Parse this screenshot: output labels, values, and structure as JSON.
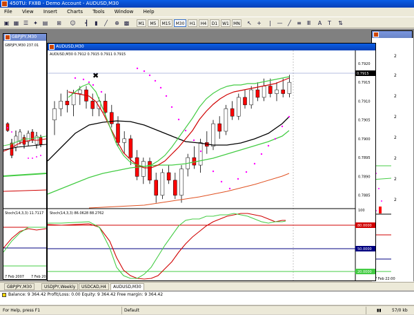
{
  "app": {
    "title": "450TU: FX8B - Demo Account - AUDUSD,M30"
  },
  "menu": [
    "File",
    "View",
    "Insert",
    "Charts",
    "Tools",
    "Window",
    "Help"
  ],
  "toolbar": {
    "timeframes": [
      "M1",
      "M5",
      "M15",
      "M30",
      "H1",
      "H4",
      "D1",
      "W1",
      "MN"
    ],
    "active_tf": "M30"
  },
  "windows": {
    "left": {
      "title": "GBPJPY,M30",
      "header": "GBPJPY,M30  237.01",
      "stoch_label": "Stoch(14,3,3) 11.7117",
      "dates": [
        "7 Feb 2007",
        "7 Feb 20"
      ]
    },
    "main": {
      "title": "AUDUSD,M30",
      "header": "AUDUSD,M30  0.7912 0.7915 0.7911 0.7915",
      "stoch_label": "Stoch(14,3,3) 86.0628 88.2762"
    },
    "behind": {
      "title": "",
      "date": "7 Feb 22:00"
    }
  },
  "tabs": [
    "GBPJPY,M30",
    "USDJPY,Weekly",
    "USDCAD,H4",
    "AUDUSD,M30"
  ],
  "active_tab": "AUDUSD,M30",
  "terminal": {
    "balance_line": "Balance: 9 364.42  Profit/Loss: 0.00  Equity: 9 364.42  Free margin: 9 364.42"
  },
  "status": {
    "help": "For Help, press F1",
    "profile": "Default",
    "traffic": "57/0 kb"
  },
  "colors": {
    "bull": "#ffffff",
    "bear": "#ff0000",
    "ma_red": "#d00000",
    "ma_green": "#44cc44",
    "ma_black": "#000000",
    "sar": "#ff00ff",
    "stoch_main": "#d00000",
    "stoch_signal": "#44cc44"
  },
  "chart_data": {
    "type": "candlestick",
    "symbol": "AUDUSD",
    "timeframe": "M30",
    "price_ticks": [
      "0.7920",
      "0.7915",
      "0.7910",
      "0.7905",
      "0.7900",
      "0.7895",
      "0.7890",
      "0.7885"
    ],
    "ylim": [
      0.7882,
      0.7922
    ],
    "current_price": "0.7915",
    "candles": [
      [
        0.7905,
        0.791,
        0.7901,
        0.7908
      ],
      [
        0.7908,
        0.7912,
        0.7906,
        0.791
      ],
      [
        0.791,
        0.7913,
        0.7907,
        0.7909
      ],
      [
        0.7909,
        0.7913,
        0.7906,
        0.7912
      ],
      [
        0.7912,
        0.7914,
        0.7909,
        0.7913
      ],
      [
        0.7913,
        0.7914,
        0.7908,
        0.791
      ],
      [
        0.791,
        0.7912,
        0.7906,
        0.7908
      ],
      [
        0.7908,
        0.7911,
        0.7906,
        0.791
      ],
      [
        0.791,
        0.7912,
        0.7906,
        0.7907
      ],
      [
        0.7907,
        0.7909,
        0.7903,
        0.7904
      ],
      [
        0.7904,
        0.7906,
        0.7898,
        0.7899
      ],
      [
        0.7899,
        0.7902,
        0.7896,
        0.79
      ],
      [
        0.79,
        0.7901,
        0.7893,
        0.7895
      ],
      [
        0.7895,
        0.7897,
        0.7889,
        0.789
      ],
      [
        0.789,
        0.7895,
        0.7888,
        0.7894
      ],
      [
        0.7894,
        0.7895,
        0.7888,
        0.7889
      ],
      [
        0.7889,
        0.7891,
        0.7883,
        0.7885
      ],
      [
        0.7885,
        0.7892,
        0.7884,
        0.7891
      ],
      [
        0.7891,
        0.7893,
        0.7888,
        0.7889
      ],
      [
        0.7889,
        0.7891,
        0.7884,
        0.7885
      ],
      [
        0.7885,
        0.7893,
        0.7883,
        0.7892
      ],
      [
        0.7892,
        0.7896,
        0.789,
        0.7895
      ],
      [
        0.7895,
        0.7898,
        0.7892,
        0.7893
      ],
      [
        0.7893,
        0.79,
        0.7891,
        0.7899
      ],
      [
        0.7899,
        0.7902,
        0.7896,
        0.7898
      ],
      [
        0.7898,
        0.7905,
        0.7897,
        0.7904
      ],
      [
        0.7904,
        0.7906,
        0.79,
        0.7902
      ],
      [
        0.7902,
        0.7909,
        0.7901,
        0.7908
      ],
      [
        0.7908,
        0.791,
        0.7905,
        0.7906
      ],
      [
        0.7906,
        0.7912,
        0.7905,
        0.7911
      ],
      [
        0.7911,
        0.7913,
        0.7908,
        0.7909
      ],
      [
        0.7909,
        0.7914,
        0.7908,
        0.7913
      ],
      [
        0.7913,
        0.7915,
        0.791,
        0.7911
      ],
      [
        0.7911,
        0.7916,
        0.791,
        0.7914
      ],
      [
        0.7914,
        0.7916,
        0.7911,
        0.7912
      ],
      [
        0.7912,
        0.7915,
        0.791,
        0.7913
      ],
      [
        0.7913,
        0.7916,
        0.7911,
        0.7912
      ],
      [
        0.7912,
        0.7917,
        0.7911,
        0.7915
      ]
    ],
    "stoch_levels": [
      "80.0000",
      "50.0000",
      "20.0000"
    ]
  }
}
